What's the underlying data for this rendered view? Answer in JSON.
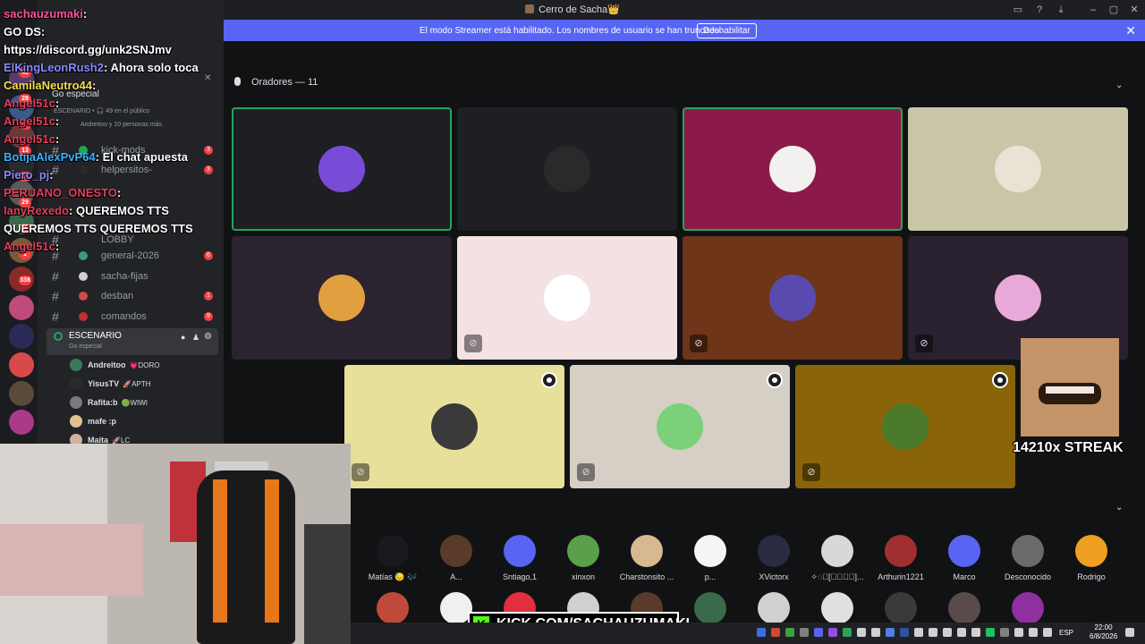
{
  "window": {
    "title": "Cerro de Sacha👑"
  },
  "banner": {
    "text": "El modo Streamer está habilitado. Los nombres de usuario se han truncado.",
    "button": "Deshabilitar"
  },
  "chat": [
    {
      "user": "sachauzumaki",
      "sep": ":",
      "text": "",
      "color": "#ff4fa0"
    },
    {
      "user": "",
      "sep": "",
      "text": "GO DS:",
      "color": "#ffffff"
    },
    {
      "user": "",
      "sep": "",
      "text": "https://discord.gg/unk2SNJmv",
      "color": "#ffffff"
    },
    {
      "user": "ElKingLeonRush2",
      "sep": ":",
      "text": "Ahora solo toca",
      "color": "#8a8aff"
    },
    {
      "user": "CamilaNeutro44",
      "sep": ":",
      "text": "",
      "color": "#f5e050"
    },
    {
      "user": "Angel51c",
      "sep": ":",
      "text": "",
      "color": "#e0405a"
    },
    {
      "user": "Angel51c",
      "sep": ":",
      "text": "",
      "color": "#e0405a"
    },
    {
      "user": "Angel51c",
      "sep": ":",
      "text": "",
      "color": "#e0405a"
    },
    {
      "user": "BotijaAlexPvP64",
      "sep": ":",
      "text": "El chat apuesta",
      "color": "#40b0ff"
    },
    {
      "user": "Piero_pj",
      "sep": ":",
      "text": "",
      "color": "#8a8aff"
    },
    {
      "user": "PERUANO_ONESTO",
      "sep": ":",
      "text": "",
      "color": "#e0405a"
    },
    {
      "user": "IanyRexedo",
      "sep": ":",
      "text": "QUEREMOS TTS",
      "color": "#e0405a"
    },
    {
      "user": "",
      "sep": "",
      "text": "QUEREMOS TTS   QUEREMOS TTS",
      "color": "#ffffff"
    },
    {
      "user": "Angel51c",
      "sep": ":",
      "text": "",
      "color": "#e0405a"
    }
  ],
  "sidebar": {
    "stage_popup": {
      "title": "Go especial",
      "meta": "ESCENARIO • 🎧 49 en el público",
      "sub": "Andreitoo y 10 personas más"
    },
    "channels": [
      {
        "name": "kick-mods",
        "count": "3"
      },
      {
        "name": "helpersitos-",
        "count": "3"
      },
      {
        "name": "LOBBY",
        "count": ""
      },
      {
        "name": "general-2026",
        "count": "6"
      },
      {
        "name": "sacha-fijas",
        "count": ""
      },
      {
        "name": "desban",
        "count": "1"
      },
      {
        "name": "comandos",
        "count": "9"
      }
    ],
    "stage": {
      "name": "ESCENARIO",
      "topic": "Go especial"
    },
    "members": [
      {
        "name": "Andreitoo",
        "tag": "💗DORO"
      },
      {
        "name": "YisusTV",
        "tag": "🚀APTH"
      },
      {
        "name": "Rafita:b",
        "tag": "🟢WIWI"
      },
      {
        "name": "mafe :p",
        "tag": ""
      },
      {
        "name": "Maita",
        "tag": "🚀LC"
      }
    ],
    "guild_badges": [
      "40",
      "28",
      "69",
      "13",
      "20",
      "29",
      "177",
      "1",
      "338"
    ]
  },
  "stage": {
    "speakers_label": "Oradores — 11",
    "speakers": [
      {
        "bg": "#1e1f22",
        "avatar": "#7a4bd6",
        "speaking": true,
        "muted": false,
        "mod": false
      },
      {
        "bg": "#1e1f22",
        "avatar": "#2a2a2a",
        "speaking": false,
        "muted": false,
        "mod": false
      },
      {
        "bg": "#8c1a48",
        "avatar": "#f3f0f0",
        "speaking": true,
        "muted": false,
        "mod": false
      },
      {
        "bg": "#c9c6a8",
        "avatar": "#e8e3d5",
        "speaking": false,
        "muted": false,
        "mod": false
      },
      {
        "bg": "#2b2330",
        "avatar": "#e0a040",
        "speaking": false,
        "muted": false,
        "mod": false
      },
      {
        "bg": "#f3e1e3",
        "avatar": "#ffffff",
        "speaking": false,
        "muted": true,
        "mod": false
      },
      {
        "bg": "#6e3518",
        "avatar": "#5a4ab0",
        "speaking": false,
        "muted": true,
        "mod": false
      },
      {
        "bg": "#2a2130",
        "avatar": "#e8a8d8",
        "speaking": false,
        "muted": true,
        "mod": false
      },
      {
        "bg": "#e7e09a",
        "avatar": "#3a3a3a",
        "speaking": false,
        "muted": true,
        "mod": true
      },
      {
        "bg": "#d6cfc6",
        "avatar": "#7bd07a",
        "speaking": false,
        "muted": true,
        "mod": true
      },
      {
        "bg": "#8a6408",
        "avatar": "#4a7a2a",
        "speaking": false,
        "muted": true,
        "mod": true
      }
    ],
    "audience": [
      {
        "name": "Matías 😓 🎶",
        "color": "#1a1a1e"
      },
      {
        "name": "A...",
        "color": "#5a3a2a"
      },
      {
        "name": "Sntiago,1",
        "color": "#5865f2"
      },
      {
        "name": "xinxon",
        "color": "#5aa04a"
      },
      {
        "name": "Charstonsito ...",
        "color": "#d8b890"
      },
      {
        "name": "p...",
        "color": "#f5f5f5"
      },
      {
        "name": "XVictorx",
        "color": "#2a2a40"
      },
      {
        "name": "✧◌⃘[𝓭𝓮𝓶𝓲]...",
        "color": "#d8d8d8"
      },
      {
        "name": "Arthurin1221",
        "color": "#a03030"
      },
      {
        "name": "Marco",
        "color": "#5865f2"
      },
      {
        "name": "Desconocido",
        "color": "#6a6a6a"
      },
      {
        "name": "Rodrigo",
        "color": "#f0a020"
      }
    ]
  },
  "overlay": {
    "streak": "14210x STREAK",
    "kick_letter": "K",
    "kick_url": "KICK.COM/SACHAUZUMAKI"
  },
  "taskbar": {
    "lang": "ESP",
    "time": "22:00",
    "date": "6/8/2026"
  }
}
